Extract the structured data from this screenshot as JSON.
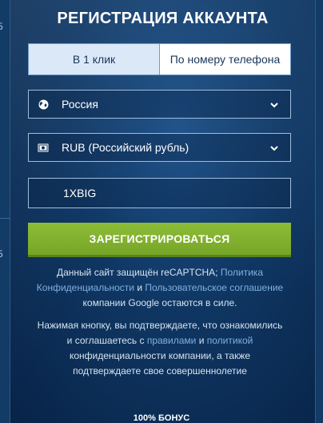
{
  "title": "РЕГИСТРАЦИЯ АККАУНТА",
  "tabs": [
    {
      "label": "В 1 клик",
      "active": true
    },
    {
      "label": "По номеру телефона",
      "active": false
    }
  ],
  "country": {
    "icon": "globe-icon",
    "value": "Россия"
  },
  "currency": {
    "icon": "banknote-icon",
    "value": "RUB (Российский рубль)"
  },
  "promo_code": {
    "value": "1XBIG"
  },
  "register_button": "ЗАРЕГИСТРИРОВАТЬСЯ",
  "recaptcha": {
    "prefix": "Данный сайт защищён reCAPTCHA; ",
    "privacy_link": "Политика Конфиденциальности",
    "and": " и ",
    "terms_link": "Пользовательское соглашение",
    "suffix": " компании Google остаются в силе."
  },
  "consent": {
    "prefix": "Нажимая кнопку, вы подтверждаете, что ознакомились и соглашаетесь с ",
    "rules_link": "правилами",
    "and": " и ",
    "policy_link": "политикой",
    "suffix": " конфиденциальности компании, а также подтверждаете свое совершеннолетие"
  },
  "bonus_label": "100% БОНУС",
  "edge_digits": [
    "5",
    "5"
  ],
  "colors": {
    "accent_green": "#8dbd37",
    "link": "#7fb0e2",
    "background": "#0b2a4e"
  }
}
